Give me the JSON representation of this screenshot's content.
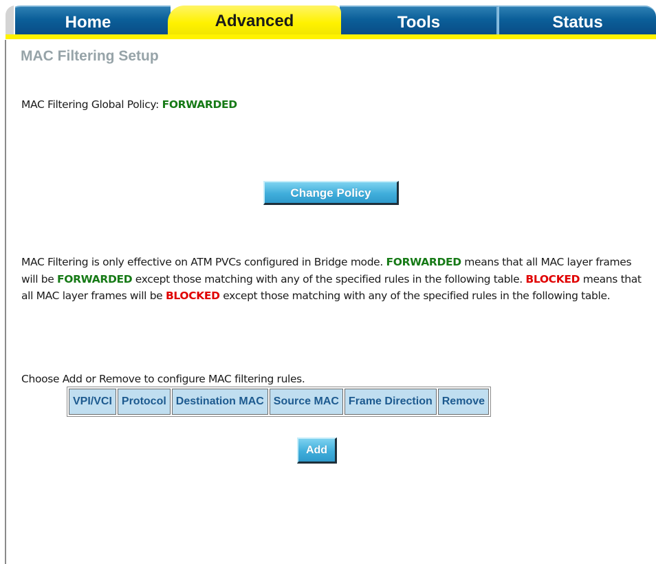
{
  "nav": {
    "tabs": [
      {
        "label": "Home"
      },
      {
        "label": "Advanced"
      },
      {
        "label": "Tools"
      },
      {
        "label": "Status"
      }
    ],
    "active_tab": "Advanced"
  },
  "page": {
    "title": "MAC Filtering Setup"
  },
  "policy": {
    "label": "MAC Filtering Global Policy: ",
    "value": "FORWARDED"
  },
  "buttons": {
    "change_policy": "Change Policy",
    "add": "Add"
  },
  "info": {
    "part1": "MAC Filtering is only effective on ATM PVCs configured in Bridge mode. ",
    "forwarded_1": "FORWARDED",
    "part2": " means that all MAC layer frames will be ",
    "forwarded_2": "FORWARDED",
    "part3": " except those matching with any of the specified rules in the following table. ",
    "blocked_1": "BLOCKED",
    "part4": " means that all MAC layer frames will be ",
    "blocked_2": "BLOCKED",
    "part5": " except those matching with any of the specified rules in the following table."
  },
  "choose_text": "Choose Add or Remove to configure MAC filtering rules.",
  "table": {
    "headers": [
      "VPI/VCI",
      "Protocol",
      "Destination MAC",
      "Source MAC",
      "Frame Direction",
      "Remove"
    ],
    "rows": []
  },
  "colors": {
    "tab_blue": "#0b5f99",
    "tab_active_yellow": "#fff200",
    "forwarded_green": "#167a16",
    "blocked_red": "#e00000",
    "title_gray": "#96a3a8",
    "table_header_bg": "#c0def0",
    "button_cyan": "#40aedb"
  }
}
